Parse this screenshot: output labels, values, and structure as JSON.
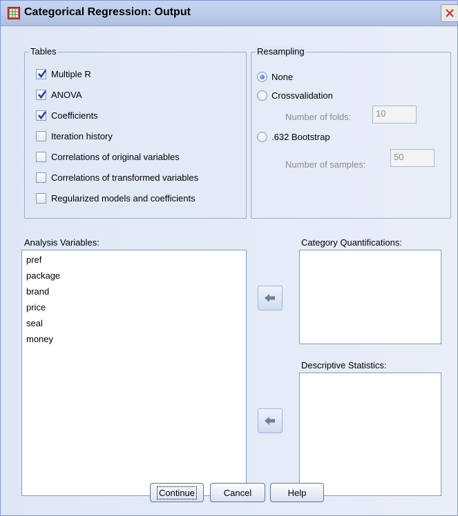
{
  "window": {
    "title": "Categorical Regression: Output",
    "title_icon": "spreadsheet-icon",
    "close_icon": "close-icon"
  },
  "tables": {
    "legend": "Tables",
    "items": [
      {
        "label": "Multiple R",
        "checked": true
      },
      {
        "label": "ANOVA",
        "checked": true
      },
      {
        "label": "Coefficients",
        "checked": true
      },
      {
        "label": "Iteration history",
        "checked": false
      },
      {
        "label": "Correlations of original variables",
        "checked": false
      },
      {
        "label": "Correlations of transformed variables",
        "checked": false
      },
      {
        "label": "Regularized models and coefficients",
        "checked": false
      }
    ]
  },
  "resampling": {
    "legend": "Resampling",
    "options": [
      {
        "label": "None",
        "selected": true
      },
      {
        "label": "Crossvalidation",
        "selected": false
      },
      {
        "label": ".632 Bootstrap",
        "selected": false
      }
    ],
    "folds_label": "Number of folds:",
    "folds_value": "10",
    "samples_label": "Number of samples:",
    "samples_value": "50"
  },
  "analysis_variables": {
    "label": "Analysis Variables:",
    "items": [
      "pref",
      "package",
      "brand",
      "price",
      "seal",
      "money"
    ]
  },
  "category_quantifications": {
    "label": "Category Quantifications:",
    "items": []
  },
  "descriptive_statistics": {
    "label": "Descriptive Statistics:",
    "items": []
  },
  "buttons": {
    "continue": "Continue",
    "cancel": "Cancel",
    "help": "Help"
  },
  "colors": {
    "accent": "#2b56c8",
    "panel": "#e1e8f6"
  }
}
